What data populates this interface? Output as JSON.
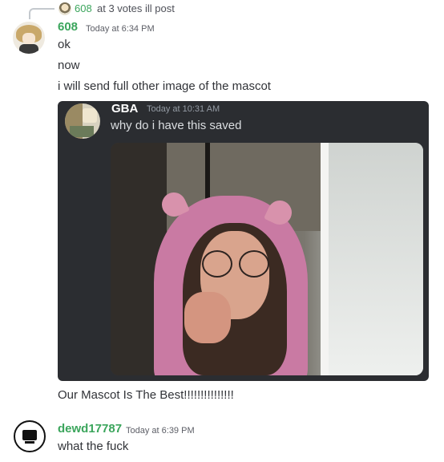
{
  "reply": {
    "username": "608",
    "text": "at 3 votes ill post",
    "avatar_icon": "user-avatar-icon"
  },
  "messages": [
    {
      "username": "608",
      "timestamp": "Today at 6:34 PM",
      "lines": [
        "ok",
        "now",
        "i will send full other image of the mascot"
      ]
    },
    {
      "username": "dewd17787",
      "timestamp": "Today at 6:39 PM",
      "lines": [
        "what the fuck"
      ]
    }
  ],
  "embed": {
    "username": "GBA",
    "timestamp": "Today at 10:31 AM",
    "text": "why do i have this saved"
  },
  "caption": "Our Mascot Is The Best!!!!!!!!!!!!!!!",
  "colors": {
    "username": "#3ba55c",
    "embed_bg": "#2b2d31",
    "background": "#ffffff"
  }
}
